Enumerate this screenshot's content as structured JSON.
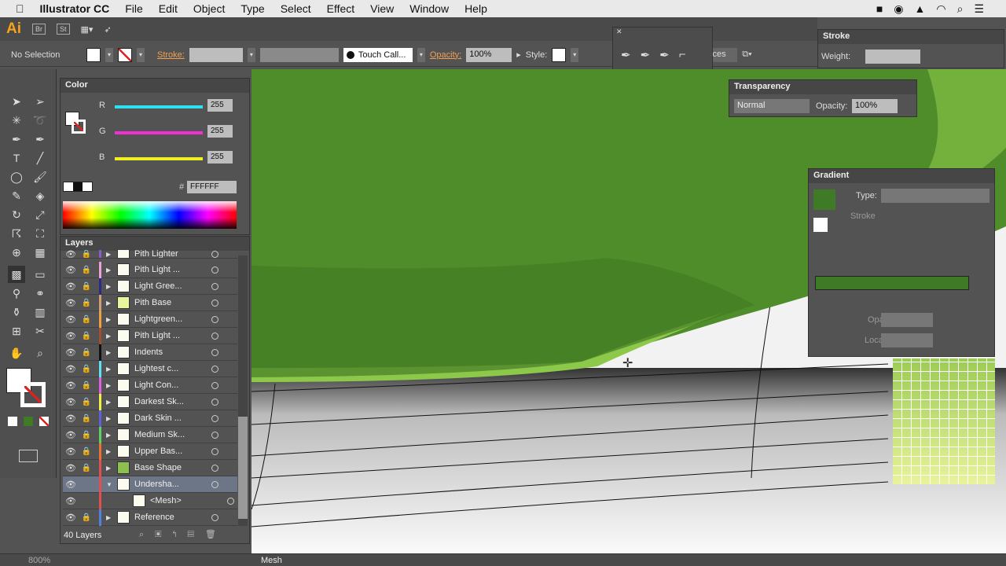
{
  "menubar": {
    "app": "Illustrator CC",
    "items": [
      "File",
      "Edit",
      "Object",
      "Type",
      "Select",
      "Effect",
      "View",
      "Window",
      "Help"
    ]
  },
  "appbar": {
    "logo": "Ai",
    "bridge": "Br",
    "stock": "St"
  },
  "control": {
    "selection": "No Selection",
    "stroke_label": "Stroke:",
    "brush": "Touch Call...",
    "opacity_label": "Opacity:",
    "opacity": "100%",
    "style_label": "Style:",
    "preferences": "ences"
  },
  "color_panel": {
    "title": "Color",
    "channels": [
      {
        "label": "R",
        "value": "255",
        "color": "#2ee0f0"
      },
      {
        "label": "G",
        "value": "255",
        "color": "#f030d0"
      },
      {
        "label": "B",
        "value": "255",
        "color": "#f0f020"
      }
    ],
    "hex_label": "#",
    "hex": "FFFFFF"
  },
  "layers_panel": {
    "title": "Layers",
    "count": "40 Layers",
    "items": [
      {
        "name": "Pith Lighter",
        "color": "#8a5ad0",
        "partial": true
      },
      {
        "name": "Pith Light ...",
        "color": "#f0a0d8"
      },
      {
        "name": "Light Gree...",
        "color": "#2a2a8a"
      },
      {
        "name": "Pith Base",
        "color": "#d0a070",
        "thumb": "#e8f5a0"
      },
      {
        "name": "Lightgreen...",
        "color": "#f0a040"
      },
      {
        "name": "Pith Light ...",
        "color": "#a05030"
      },
      {
        "name": "Indents",
        "color": "#111111"
      },
      {
        "name": "Lightest c...",
        "color": "#60e0f0"
      },
      {
        "name": "Light Con...",
        "color": "#e060e0"
      },
      {
        "name": "Darkest Sk...",
        "color": "#f0f040"
      },
      {
        "name": "Dark Skin ...",
        "color": "#6060d8"
      },
      {
        "name": "Medium Sk...",
        "color": "#60d060"
      },
      {
        "name": "Upper Bas...",
        "color": "#f07030"
      },
      {
        "name": "Base Shape",
        "color": "#e05050",
        "thumb": "#8cc050"
      },
      {
        "name": "Undersha...",
        "color": "#e05050",
        "selected": true,
        "expanded": true
      },
      {
        "name": "<Mesh>",
        "color": "#e05050",
        "child": true
      },
      {
        "name": "Reference",
        "color": "#5080e0"
      }
    ]
  },
  "stroke_panel": {
    "title": "Stroke",
    "weight_label": "Weight:"
  },
  "transparency_panel": {
    "title": "Transparency",
    "mode": "Normal",
    "opacity_label": "Opacity:",
    "opacity": "100%"
  },
  "gradient_panel": {
    "title": "Gradient",
    "type_label": "Type:",
    "stroke_label": "Stroke",
    "opacity_label": "Opacity:",
    "location_label": "Location:",
    "color": "#3f7a26"
  },
  "status": {
    "zoom": "800%",
    "tool": "Mesh"
  },
  "colors": {
    "leaf_green": "#4f8c2a",
    "highlight": "#8cc84a"
  }
}
